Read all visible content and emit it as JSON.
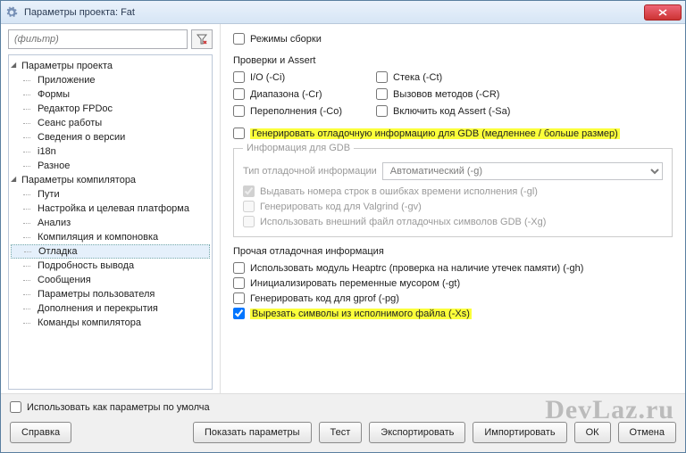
{
  "window": {
    "title": "Параметры проекта: Fat"
  },
  "filter": {
    "placeholder": "(фильтр)"
  },
  "tree": {
    "groups": [
      {
        "label": "Параметры проекта",
        "items": [
          "Приложение",
          "Формы",
          "Редактор FPDoc",
          "Сеанс работы",
          "Сведения о версии",
          "i18n",
          "Разное"
        ]
      },
      {
        "label": "Параметры компилятора",
        "items": [
          "Пути",
          "Настройка и целевая платформа",
          "Анализ",
          "Компиляция и компоновка",
          "Отладка",
          "Подробность вывода",
          "Сообщения",
          "Параметры пользователя",
          "Дополнения и перекрытия",
          "Команды компилятора"
        ]
      }
    ],
    "selected": "Отладка"
  },
  "right": {
    "buildModes": "Режимы сборки",
    "checksHeader": "Проверки и Assert",
    "checks": {
      "io": "I/O (-Ci)",
      "stack": "Стека (-Ct)",
      "range": "Диапазона (-Cr)",
      "method": "Вызовов методов (-CR)",
      "overflow": "Переполнения (-Co)",
      "assert": "Включить код Assert (-Sa)"
    },
    "genDebug": "Генерировать отладочную информацию для GDB (медленнее / больше размер)",
    "gdbGroup": "Информация для GDB",
    "dbgTypeLabel": "Тип отладочной информации",
    "dbgTypeValue": "Автоматический (-g)",
    "lineInfo": "Выдавать номера строк в ошибках времени исполнения (-gl)",
    "valgrind": "Генерировать код для Valgrind (-gv)",
    "extSym": "Использовать внешний файл отладочных символов GDB (-Xg)",
    "otherHeader": "Прочая отладочная информация",
    "heaptrc": "Использовать модуль Heaptrc (проверка на наличие утечек памяти) (-gh)",
    "trash": "Инициализировать переменные мусором (-gt)",
    "gprof": "Генерировать код для gprof (-pg)",
    "strip": "Вырезать символы из исполнимого файла (-Xs)"
  },
  "footer": {
    "defaults": "Использовать как параметры по умолча",
    "help": "Справка",
    "show": "Показать параметры",
    "test": "Тест",
    "export": "Экспортировать",
    "import": "Импортировать",
    "ok": "ОК",
    "cancel": "Отмена"
  },
  "watermark": "DevLaz.ru"
}
